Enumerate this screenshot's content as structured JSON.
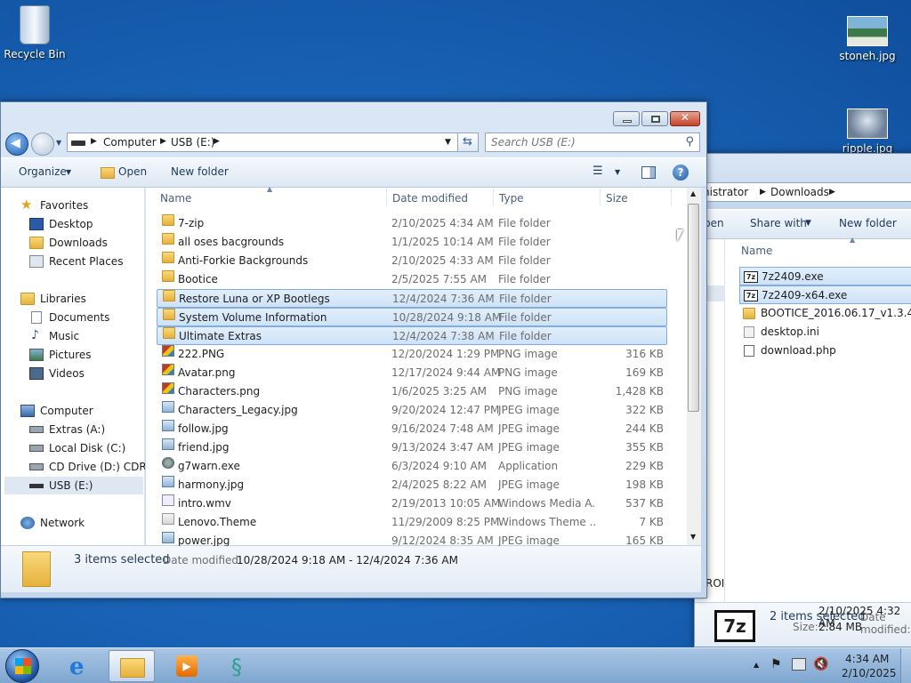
{
  "desktop": {
    "recycle_bin": "Recycle Bin",
    "stoneh": "stoneh.jpg",
    "ripple": "ripple.jpg"
  },
  "main": {
    "breadcrumb": [
      "Computer",
      "USB (E:)"
    ],
    "search_placeholder": "Search USB (E:)",
    "toolbar": {
      "organize": "Organize",
      "open": "Open",
      "new_folder": "New folder"
    },
    "nav": {
      "favorites": "Favorites",
      "desktop": "Desktop",
      "downloads": "Downloads",
      "recent": "Recent Places",
      "libraries": "Libraries",
      "documents": "Documents",
      "music": "Music",
      "pictures": "Pictures",
      "videos": "Videos",
      "computer": "Computer",
      "extras": "Extras (A:)",
      "local": "Local Disk (C:)",
      "cd": "CD Drive (D:) CDROM",
      "usb": "USB (E:)",
      "network": "Network"
    },
    "columns": {
      "name": "Name",
      "date": "Date modified",
      "type": "Type",
      "size": "Size"
    },
    "files": [
      {
        "name": "7-zip",
        "date": "2/10/2025 4:34 AM",
        "type": "File folder",
        "size": "",
        "icon": "folder",
        "sel": false
      },
      {
        "name": "all oses bacgrounds",
        "date": "1/1/2025 10:14 AM",
        "type": "File folder",
        "size": "",
        "icon": "folder",
        "sel": false
      },
      {
        "name": "Anti-Forkie Backgrounds",
        "date": "2/10/2025 4:33 AM",
        "type": "File folder",
        "size": "",
        "icon": "folder",
        "sel": false
      },
      {
        "name": "Bootice",
        "date": "2/5/2025 7:55 AM",
        "type": "File folder",
        "size": "",
        "icon": "folder",
        "sel": false
      },
      {
        "name": "Restore Luna or XP Bootlegs",
        "date": "12/4/2024 7:36 AM",
        "type": "File folder",
        "size": "",
        "icon": "folder",
        "sel": true
      },
      {
        "name": "System Volume Information",
        "date": "10/28/2024 9:18 AM",
        "type": "File folder",
        "size": "",
        "icon": "folder",
        "sel": true
      },
      {
        "name": "Ultimate Extras",
        "date": "12/4/2024 7:38 AM",
        "type": "File folder",
        "size": "",
        "icon": "folder",
        "sel": true
      },
      {
        "name": "222.PNG",
        "date": "12/20/2024 1:29 PM",
        "type": "PNG image",
        "size": "316 KB",
        "icon": "png",
        "sel": false
      },
      {
        "name": "Avatar.png",
        "date": "12/17/2024 9:44 AM",
        "type": "PNG image",
        "size": "169 KB",
        "icon": "png",
        "sel": false
      },
      {
        "name": "Characters.png",
        "date": "1/6/2025 3:25 AM",
        "type": "PNG image",
        "size": "1,428 KB",
        "icon": "png",
        "sel": false
      },
      {
        "name": "Characters_Legacy.jpg",
        "date": "9/20/2024 12:47 PM",
        "type": "JPEG image",
        "size": "322 KB",
        "icon": "jpg",
        "sel": false
      },
      {
        "name": "follow.jpg",
        "date": "9/16/2024 7:48 AM",
        "type": "JPEG image",
        "size": "244 KB",
        "icon": "jpg",
        "sel": false
      },
      {
        "name": "friend.jpg",
        "date": "9/13/2024 3:47 AM",
        "type": "JPEG image",
        "size": "355 KB",
        "icon": "jpg",
        "sel": false
      },
      {
        "name": "g7warn.exe",
        "date": "6/3/2024 9:10 AM",
        "type": "Application",
        "size": "229 KB",
        "icon": "exe",
        "sel": false
      },
      {
        "name": "harmony.jpg",
        "date": "2/4/2025 8:22 AM",
        "type": "JPEG image",
        "size": "198 KB",
        "icon": "jpg",
        "sel": false
      },
      {
        "name": "intro.wmv",
        "date": "2/19/2013 10:05 AM",
        "type": "Windows Media A...",
        "size": "537 KB",
        "icon": "wmv",
        "sel": false
      },
      {
        "name": "Lenovo.Theme",
        "date": "11/29/2009 8:25 PM",
        "type": "Windows Theme ...",
        "size": "7 KB",
        "icon": "theme",
        "sel": false
      },
      {
        "name": "power.jpg",
        "date": "9/12/2024 8:35 AM",
        "type": "JPEG image",
        "size": "165 KB",
        "icon": "jpg",
        "sel": false
      }
    ],
    "status": {
      "count": "3 items selected",
      "date_label": "Date modified:",
      "date_value": "10/28/2024 9:18 AM - 12/4/2024 7:36 AM"
    }
  },
  "back_window": {
    "breadcrumb": [
      "nistrator",
      "Downloads"
    ],
    "toolbar": {
      "open": "pen",
      "share": "Share with",
      "new_folder": "New folder"
    },
    "col_name": "Name",
    "nav_partial": "ROI",
    "files": [
      {
        "name": "7z2409.exe",
        "icon": "7z",
        "sel": true
      },
      {
        "name": "7z2409-x64.exe",
        "icon": "7z",
        "sel": true
      },
      {
        "name": "BOOTICE_2016.06.17_v1.3.4.0.zip",
        "icon": "folder",
        "sel": false
      },
      {
        "name": "desktop.ini",
        "icon": "ini",
        "sel": false
      },
      {
        "name": "download.php",
        "icon": "php",
        "sel": false
      }
    ],
    "status": {
      "count": "2 items selected",
      "date_label": "Date modified:",
      "date_value": "2/10/2025 4:32 AM",
      "size_label": "Size:",
      "size_value": "2.84 MB",
      "logo": "7z"
    }
  },
  "taskbar": {
    "time": "4:34 AM",
    "date": "2/10/2025"
  }
}
